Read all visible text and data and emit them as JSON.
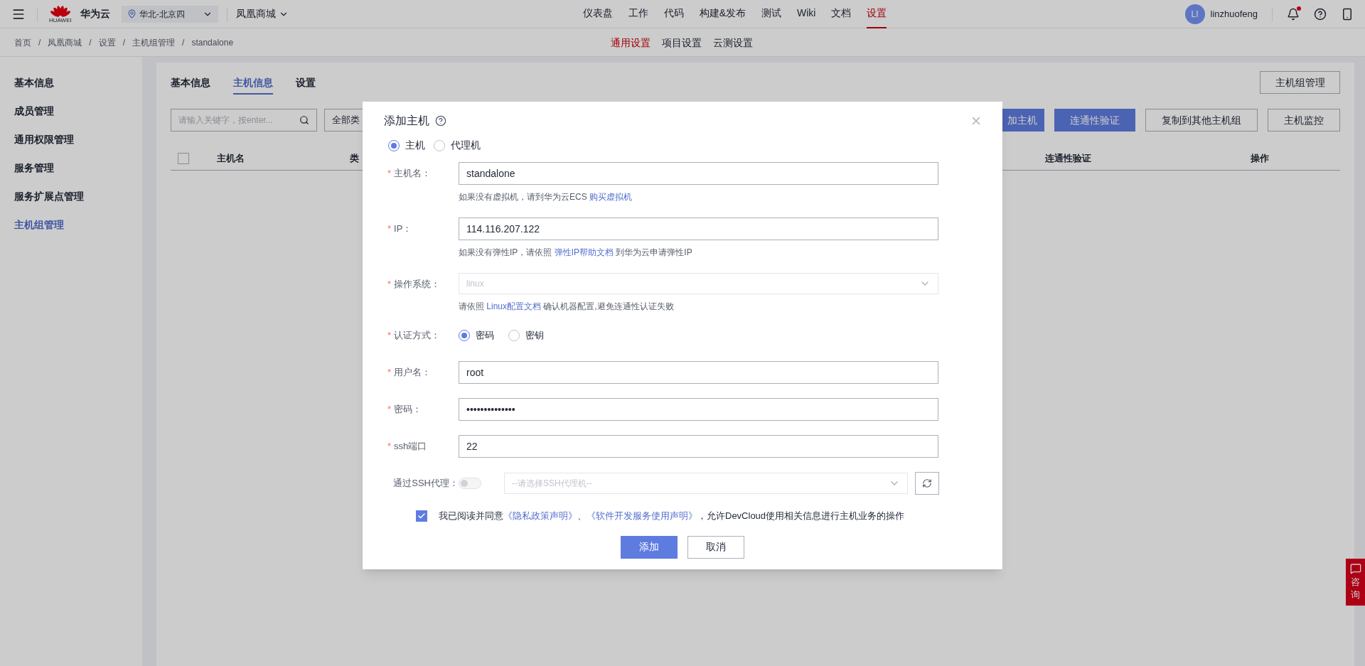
{
  "top_bar": {
    "logo_text": "HUAWEI",
    "brand": "华为云",
    "region": "华北-北京四",
    "project": "凤凰商城",
    "nav": [
      {
        "label": "仪表盘",
        "selected": false
      },
      {
        "label": "工作",
        "selected": false
      },
      {
        "label": "代码",
        "selected": false
      },
      {
        "label": "构建&发布",
        "selected": false
      },
      {
        "label": "测试",
        "selected": false
      },
      {
        "label": "Wiki",
        "selected": false
      },
      {
        "label": "文档",
        "selected": false
      },
      {
        "label": "设置",
        "selected": true
      }
    ],
    "user": {
      "initials": "LI",
      "name": "linzhuofeng"
    },
    "notification_dot": true
  },
  "breadcrumb": {
    "separator": "/",
    "items": [
      "首页",
      "凤凰商城",
      "设置",
      "主机组管理",
      "standalone"
    ]
  },
  "settings_tabs": [
    {
      "label": "通用设置",
      "selected": true
    },
    {
      "label": "项目设置",
      "selected": false
    },
    {
      "label": "云测设置",
      "selected": false
    }
  ],
  "sidebar": {
    "items": [
      {
        "label": "基本信息",
        "selected": false
      },
      {
        "label": "成员管理",
        "selected": false
      },
      {
        "label": "通用权限管理",
        "selected": false
      },
      {
        "label": "服务管理",
        "selected": false
      },
      {
        "label": "服务扩展点管理",
        "selected": false
      },
      {
        "label": "主机组管理",
        "selected": true
      }
    ]
  },
  "content": {
    "tabs": [
      {
        "label": "基本信息",
        "selected": false
      },
      {
        "label": "主机信息",
        "selected": true
      },
      {
        "label": "设置",
        "selected": false
      }
    ],
    "manage_button": "主机组管理",
    "search": {
      "placeholder": "请输入关键字，按enter..."
    },
    "type_filter": "全部类",
    "toolbar_buttons": [
      {
        "label": "加主机",
        "kind": "primary"
      },
      {
        "label": "连通性验证",
        "kind": "primary"
      },
      {
        "label": "复制到其他主机组",
        "kind": "default"
      },
      {
        "label": "主机监控",
        "kind": "default"
      }
    ],
    "table": {
      "select_all_checked": false,
      "columns": [
        "主机名",
        "类",
        "连通性验证",
        "操作"
      ]
    }
  },
  "dialog": {
    "title": "添加主机",
    "required_mark": "*",
    "host_type": [
      {
        "label": "主机",
        "selected": true
      },
      {
        "label": "代理机",
        "selected": false
      }
    ],
    "fields": [
      {
        "kind": "input",
        "label": "主机名：",
        "required": true,
        "value": "standalone",
        "hint": [
          {
            "text": "如果没有虚拟机，请到华为云ECS "
          },
          {
            "text": "购买虚拟机",
            "link": true
          }
        ]
      },
      {
        "kind": "input",
        "label": "IP：",
        "required": true,
        "value": "114.116.207.122",
        "hint": [
          {
            "text": "如果没有弹性IP，请依照 "
          },
          {
            "text": "弹性IP帮助文档",
            "link": true
          },
          {
            "text": " 到华为云申请弹性IP"
          }
        ]
      },
      {
        "kind": "select",
        "label": "操作系统：",
        "required": true,
        "disabled": true,
        "value": "linux",
        "hint": [
          {
            "text": "请依照 "
          },
          {
            "text": "Linux配置文档",
            "link": true
          },
          {
            "text": " 确认机器配置,避免连通性认证失败"
          }
        ]
      },
      {
        "kind": "radio",
        "label": "认证方式：",
        "required": true,
        "options": [
          {
            "label": "密码",
            "selected": true
          },
          {
            "label": "密钥",
            "selected": false
          }
        ]
      },
      {
        "kind": "input",
        "label": "用户名：",
        "required": true,
        "value": "root"
      },
      {
        "kind": "input",
        "label": "密码：",
        "required": true,
        "value": "••••••••••••••"
      },
      {
        "kind": "input",
        "label": "ssh端口",
        "required": true,
        "value": "22"
      },
      {
        "kind": "proxy",
        "label": "通过SSH代理：",
        "required": false,
        "on": false,
        "placeholder": "--请选择SSH代理机--"
      }
    ],
    "agreement": {
      "checked": true,
      "parts": [
        {
          "text": "我已阅读并同意"
        },
        {
          "text": "《隐私政策声明》",
          "link": true
        },
        {
          "text": "、"
        },
        {
          "text": "《软件开发服务使用声明》",
          "link": true
        },
        {
          "text": "，允许DevCloud使用相关信息进行主机业务的操作"
        }
      ]
    },
    "buttons": [
      {
        "label": "添加",
        "kind": "primary"
      },
      {
        "label": "取消",
        "kind": "default"
      }
    ]
  },
  "consult_button": {
    "label": "咨询"
  }
}
